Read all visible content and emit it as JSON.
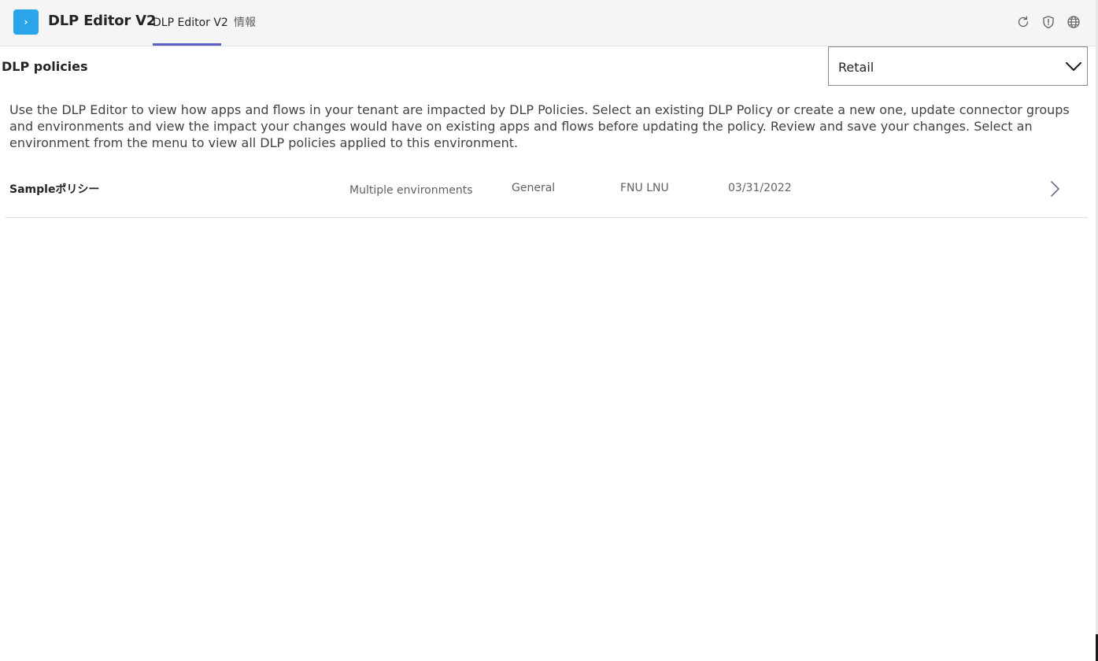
{
  "header": {
    "app_icon_glyph": "›",
    "app_title": "DLP Editor V2",
    "tabs": [
      {
        "label": "DLP Editor V2",
        "active": true
      },
      {
        "label": "情報",
        "active": false
      }
    ],
    "icons": [
      "refresh-icon",
      "shield-icon",
      "globe-icon"
    ],
    "accent_color": "#5b5fc7",
    "app_icon_color": "#2aa5ec"
  },
  "main": {
    "section_title": "DLP policies",
    "environment_select": {
      "value": "Retail"
    },
    "description": "Use the DLP Editor to view how apps and flows in your tenant are impacted by DLP Policies. Select an existing DLP Policy or create a new one, update connector groups and environments and view the impact your changes would have on existing apps and flows before updating the policy. Review and save your changes. Select an environment from the menu to view all DLP policies applied to this environment.",
    "policies": [
      {
        "name": "Sampleポリシー",
        "environments": "Multiple environments",
        "group": "General",
        "owner": "FNU LNU",
        "date": "03/31/2022"
      }
    ]
  }
}
